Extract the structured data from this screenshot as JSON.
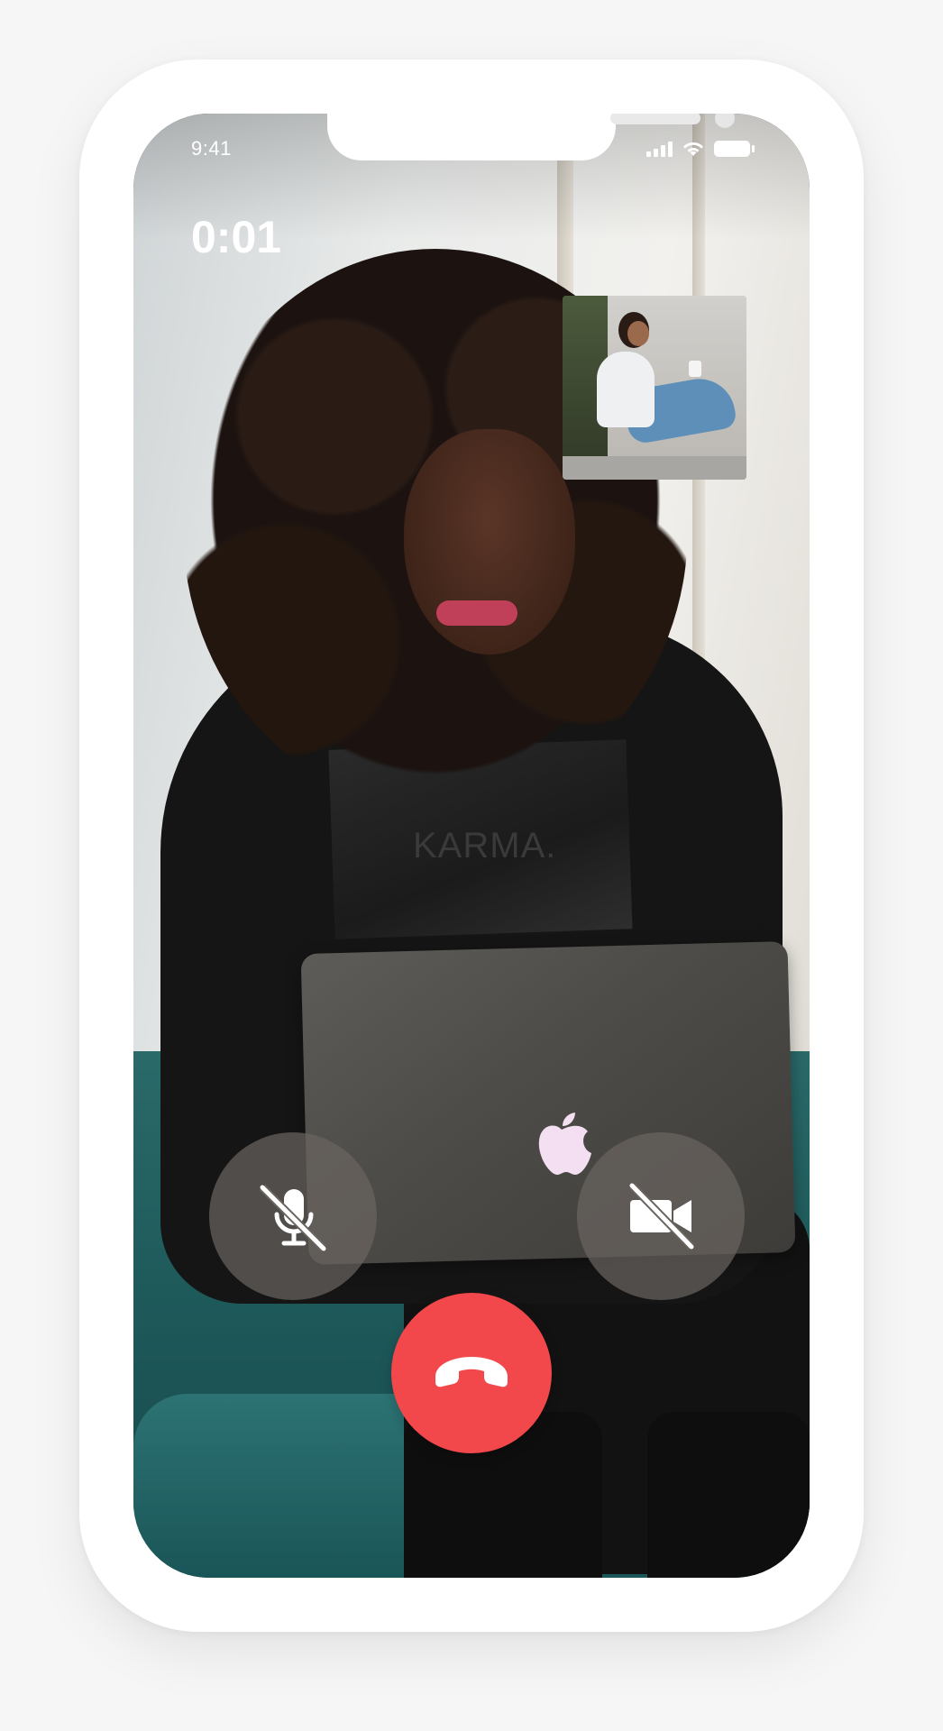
{
  "status_bar": {
    "time": "9:41"
  },
  "call": {
    "timer": "0:01"
  },
  "remote_video": {
    "shirt_text": "KARMA."
  },
  "controls": {
    "mute_icon": "microphone-slash-icon",
    "video_icon": "video-camera-slash-icon",
    "end_icon": "phone-hangup-icon"
  },
  "colors": {
    "end_call": "#f2474b",
    "control_bg": "rgba(105,100,96,0.72)",
    "text": "#ffffff"
  }
}
